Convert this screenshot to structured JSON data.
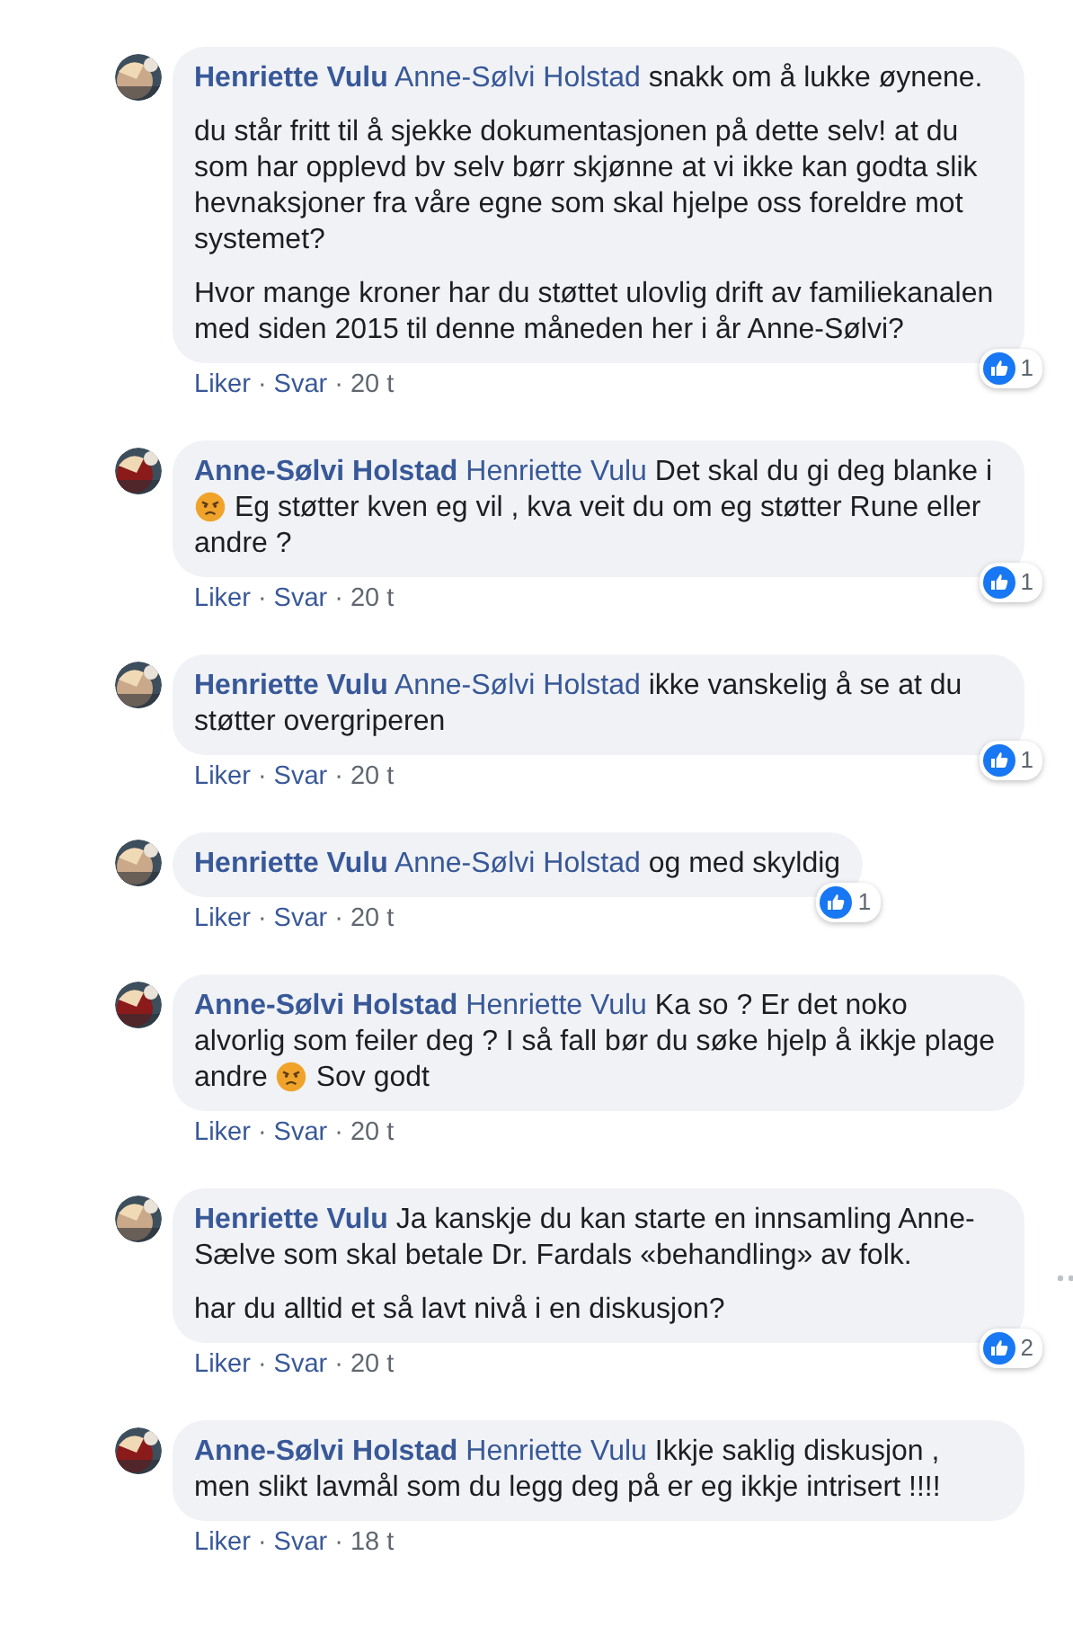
{
  "comments": [
    {
      "author": "Henriette Vulu",
      "mention": "Anne-Sølvi Holstad",
      "avatar": {
        "kind": "picture",
        "color": "#c9a98a"
      },
      "paragraphs": [
        [
          {
            "kind": "text",
            "text": "snakk om å lukke øynene."
          }
        ],
        [
          {
            "kind": "text",
            "text": "du står fritt til å sjekke dokumentasjonen på dette selv! at du som har opplevd bv selv børr skjønne at vi ikke kan godta slik hevnaksjoner fra våre egne som skal hjelpe oss foreldre mot systemet?"
          }
        ],
        [
          {
            "kind": "text",
            "text": "Hvor mange kroner har du støttet ulovlig drift av familiekanalen med siden 2015 til denne måneden her i år Anne-Sølvi?"
          }
        ]
      ],
      "actions": [
        {
          "kind": "link",
          "text": "Liker"
        },
        {
          "kind": "dot",
          "text": "·"
        },
        {
          "kind": "link",
          "text": "Svar"
        },
        {
          "kind": "dot",
          "text": "·"
        },
        {
          "kind": "time",
          "text": "20 t"
        }
      ],
      "likes": "1",
      "more_options": false
    },
    {
      "author": "Anne-Sølvi Holstad",
      "mention": "Henriette Vulu",
      "avatar": {
        "kind": "picture",
        "color": "#8b1a1a"
      },
      "paragraphs": [
        [
          {
            "kind": "text",
            "text": "Det skal du gi deg blanke i "
          },
          {
            "kind": "emoji"
          },
          {
            "kind": "text",
            "text": " Eg støtter kven eg vil , kva veit du om eg støtter Rune eller andre ?"
          }
        ]
      ],
      "actions": [
        {
          "kind": "link",
          "text": "Liker"
        },
        {
          "kind": "dot",
          "text": "·"
        },
        {
          "kind": "link",
          "text": "Svar"
        },
        {
          "kind": "dot",
          "text": "·"
        },
        {
          "kind": "time",
          "text": "20 t"
        }
      ],
      "likes": "1",
      "more_options": false
    },
    {
      "author": "Henriette Vulu",
      "mention": "Anne-Sølvi Holstad",
      "avatar": {
        "kind": "picture",
        "color": "#c9a98a"
      },
      "paragraphs": [
        [
          {
            "kind": "text",
            "text": "ikke vanskelig å se at du støtter overgriperen"
          }
        ]
      ],
      "actions": [
        {
          "kind": "link",
          "text": "Liker"
        },
        {
          "kind": "dot",
          "text": "·"
        },
        {
          "kind": "link",
          "text": "Svar"
        },
        {
          "kind": "dot",
          "text": "·"
        },
        {
          "kind": "time",
          "text": "20 t"
        }
      ],
      "likes": "1",
      "more_options": false
    },
    {
      "author": "Henriette Vulu",
      "mention": "Anne-Sølvi Holstad",
      "avatar": {
        "kind": "picture",
        "color": "#c9a98a"
      },
      "paragraphs": [
        [
          {
            "kind": "text",
            "text": "og med skyldig"
          }
        ]
      ],
      "actions": [
        {
          "kind": "link",
          "text": "Liker"
        },
        {
          "kind": "dot",
          "text": "·"
        },
        {
          "kind": "link",
          "text": "Svar"
        },
        {
          "kind": "dot",
          "text": "·"
        },
        {
          "kind": "time",
          "text": "20 t"
        }
      ],
      "likes": "1",
      "more_options": false
    },
    {
      "author": "Anne-Sølvi Holstad",
      "mention": "Henriette Vulu",
      "avatar": {
        "kind": "picture",
        "color": "#8b1a1a"
      },
      "paragraphs": [
        [
          {
            "kind": "text",
            "text": "Ka so ? Er det noko alvorlig som feiler deg ? I så fall bør du søke hjelp å ikkje plage andre "
          },
          {
            "kind": "emoji"
          },
          {
            "kind": "text",
            "text": " Sov godt"
          }
        ]
      ],
      "actions": [
        {
          "kind": "link",
          "text": "Liker"
        },
        {
          "kind": "dot",
          "text": "·"
        },
        {
          "kind": "link",
          "text": "Svar"
        },
        {
          "kind": "dot",
          "text": "·"
        },
        {
          "kind": "time",
          "text": "20 t"
        }
      ],
      "more_options": false
    },
    {
      "author": "Henriette Vulu",
      "avatar": {
        "kind": "picture",
        "color": "#c9a98a"
      },
      "paragraphs": [
        [
          {
            "kind": "text",
            "text": "Ja kanskje du kan starte en innsamling Anne-Sælve som skal betale Dr. Fardals «behandling» av folk."
          }
        ],
        [
          {
            "kind": "text",
            "text": "har du alltid et så lavt nivå i en diskusjon?"
          }
        ]
      ],
      "actions": [
        {
          "kind": "link",
          "text": "Liker"
        },
        {
          "kind": "dot",
          "text": "·"
        },
        {
          "kind": "link",
          "text": "Svar"
        },
        {
          "kind": "dot",
          "text": "·"
        },
        {
          "kind": "time",
          "text": "20 t"
        }
      ],
      "likes": "2",
      "more_options": true
    },
    {
      "author": "Anne-Sølvi Holstad",
      "mention": "Henriette Vulu",
      "avatar": {
        "kind": "picture",
        "color": "#8b1a1a"
      },
      "paragraphs": [
        [
          {
            "kind": "text",
            "text": "Ikkje saklig diskusjon , men slikt lavmål som du legg deg på er eg ikkje intrisert !!!!"
          }
        ]
      ],
      "actions": [
        {
          "kind": "link",
          "text": "Liker"
        },
        {
          "kind": "dot",
          "text": "·"
        },
        {
          "kind": "link",
          "text": "Svar"
        },
        {
          "kind": "dot",
          "text": "·"
        },
        {
          "kind": "time",
          "text": "18 t"
        }
      ],
      "more_options": false
    }
  ]
}
